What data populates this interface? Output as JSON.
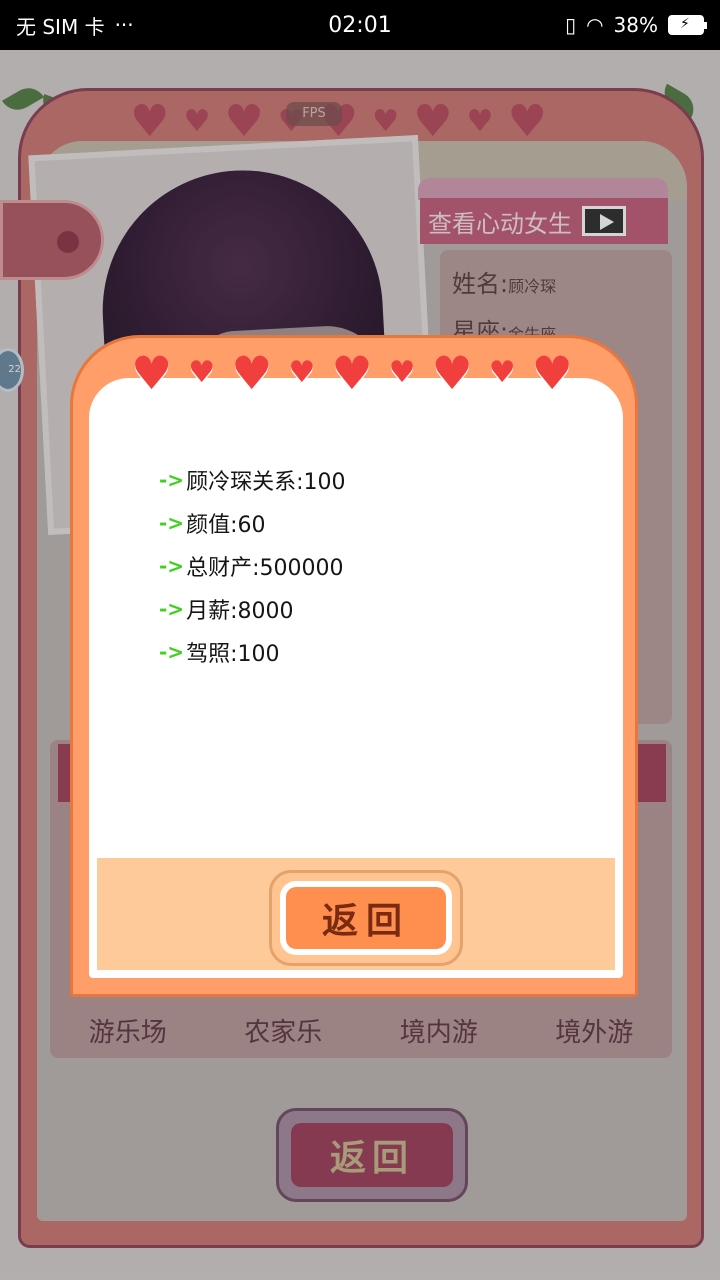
{
  "status_bar": {
    "carrier": "无 SIM 卡",
    "more": "···",
    "time": "02:01",
    "battery_percent": "38%"
  },
  "background": {
    "fps": "FPS",
    "side_badge": "22",
    "view_girl_label": "查看心动女生",
    "name_label": "姓名:",
    "name_value": "顾冷琛",
    "constellation_label": "星座:",
    "constellation_value": "金牛座",
    "destinations": [
      "游乐场",
      "农家乐",
      "境内游",
      "境外游"
    ],
    "return_label": "返回"
  },
  "dialog": {
    "arrow": "->",
    "stats": [
      "顾冷琛关系:100",
      "颜值:60",
      "总财产:500000",
      "月薪:8000",
      "驾照:100"
    ],
    "return_label": "返回"
  },
  "colors": {
    "dialog_frame": "#ff9e68",
    "heart": "#f13f3d",
    "return_button": "#ff8f4f",
    "arrow_green": "#40d11f"
  }
}
